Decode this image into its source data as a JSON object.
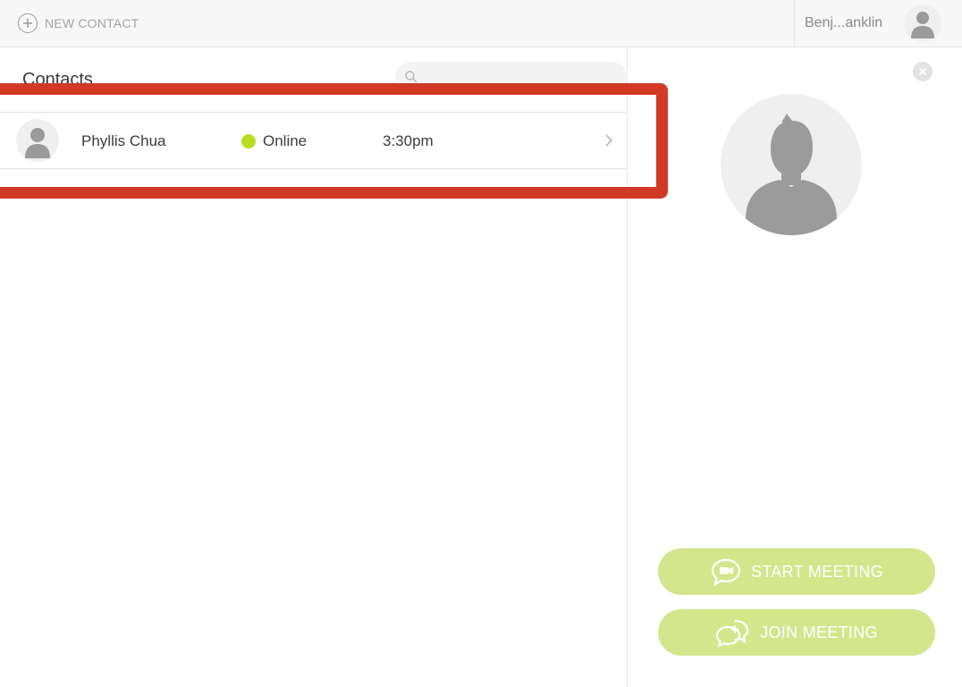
{
  "topbar": {
    "new_contact_label": "NEW CONTACT",
    "user_name": "Benj...anklin"
  },
  "contacts": {
    "title": "Contacts",
    "search_placeholder": "",
    "rows": [
      {
        "name": "Phyllis Chua",
        "status": "Online",
        "time": "3:30pm"
      }
    ]
  },
  "detail": {
    "start_meeting_label": "START MEETING",
    "join_meeting_label": "JOIN MEETING"
  },
  "colors": {
    "online": "#b6df1f",
    "button": "#d4e68b",
    "highlight": "#d23a26"
  },
  "icons": [
    "plus-circle-icon",
    "user-avatar-icon",
    "search-icon",
    "chevron-right-icon",
    "close-icon",
    "video-chat-icon",
    "chat-plus-icon"
  ]
}
